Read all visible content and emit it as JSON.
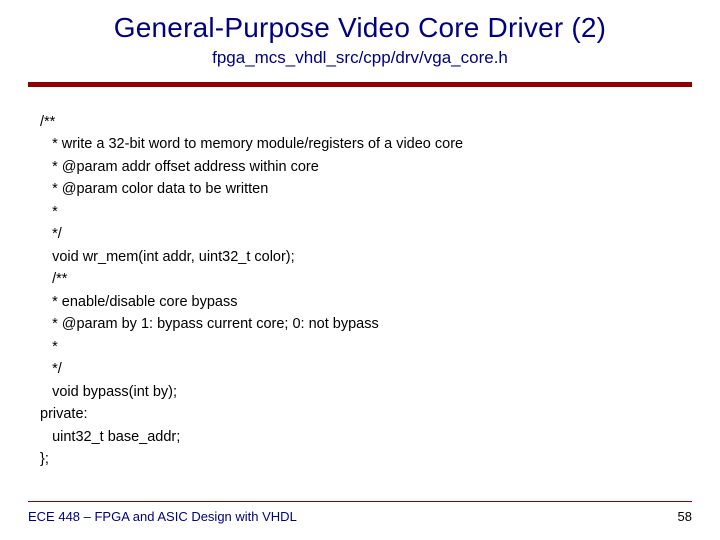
{
  "title": "General-Purpose Video Core Driver (2)",
  "subtitle": "fpga_mcs_vhdl_src/cpp/drv/vga_core.h",
  "code": "/**\n   * write a 32-bit word to memory module/registers of a video core\n   * @param addr offset address within core\n   * @param color data to be written\n   *\n   */\n   void wr_mem(int addr, uint32_t color);\n   /**\n   * enable/disable core bypass\n   * @param by 1: bypass current core; 0: not bypass\n   *\n   */\n   void bypass(int by);\nprivate:\n   uint32_t base_addr;\n};",
  "footer": {
    "course": "ECE 448 – FPGA and ASIC Design with VHDL",
    "page": "58"
  }
}
